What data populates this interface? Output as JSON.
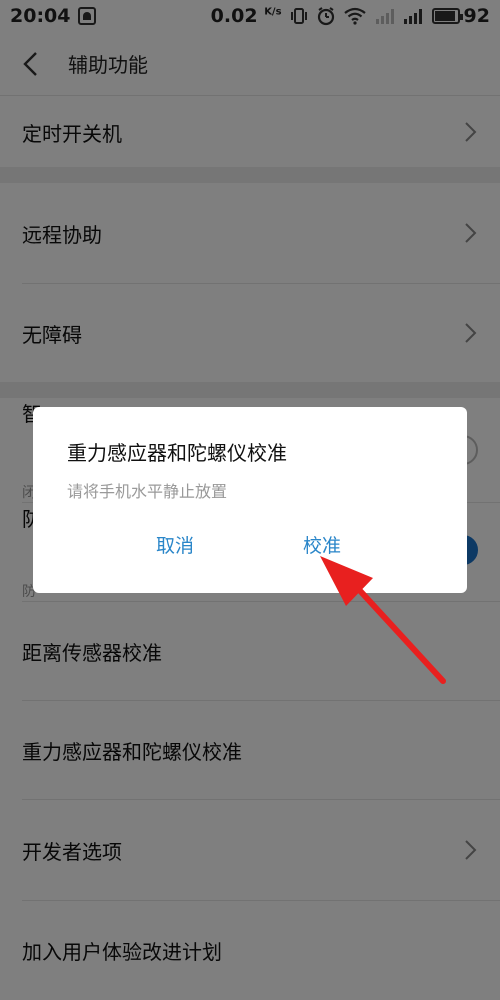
{
  "status_bar": {
    "time": "20:04",
    "speed": "0.02",
    "speed_unit": "K/s",
    "battery": "92",
    "icons": [
      "notification-icon",
      "vibrate-icon",
      "alarm-icon",
      "wifi-icon",
      "signal-3g-icon",
      "signal-icon",
      "battery-icon"
    ]
  },
  "header": {
    "title": "辅助功能"
  },
  "list": {
    "items": [
      {
        "label": "定时开关机",
        "chevron": true
      },
      {
        "label": "远程协助",
        "chevron": true
      },
      {
        "label": "无障碍",
        "chevron": true
      },
      {
        "label": "智",
        "sub": "闭",
        "toggle": false
      },
      {
        "label": "防",
        "sub": "防",
        "toggle": true
      },
      {
        "label": "距离传感器校准",
        "chevron": false
      },
      {
        "label": "重力感应器和陀螺仪校准",
        "chevron": false
      },
      {
        "label": "开发者选项",
        "chevron": true
      },
      {
        "label": "加入用户体验改进计划",
        "chevron": false
      }
    ]
  },
  "dialog": {
    "title": "重力感应器和陀螺仪校准",
    "message": "请将手机水平静止放置",
    "cancel_label": "取消",
    "confirm_label": "校准"
  },
  "colors": {
    "accent": "#2a86c9",
    "annotation_arrow": "#e8201f"
  }
}
